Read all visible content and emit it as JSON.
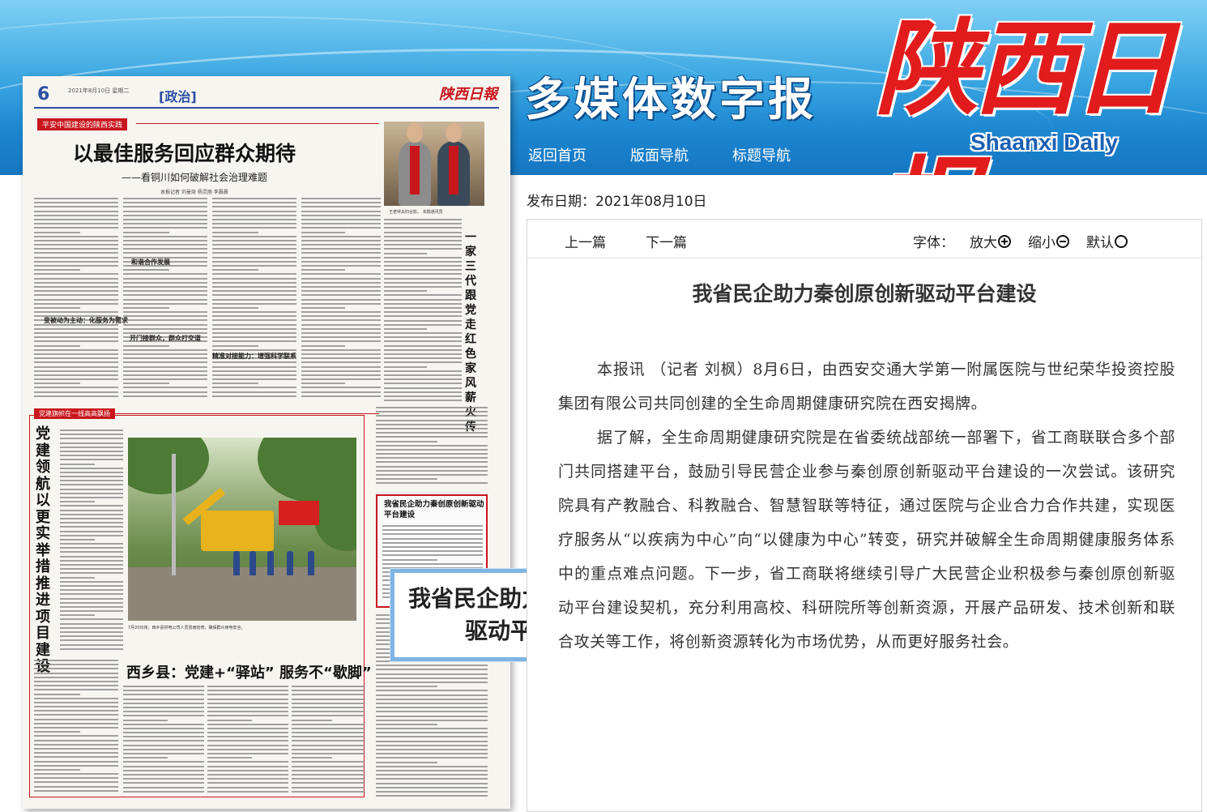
{
  "header": {
    "site_title": "多媒体数字报",
    "logo_cn": "陕西日报",
    "logo_en": "Shaanxi Daily",
    "nav": [
      "返回首页",
      "版面导航",
      "标题导航"
    ],
    "colors": {
      "header_blue": "#1c86d0",
      "logo_red": "#e21c1c"
    }
  },
  "publish": {
    "label": "发布日期：",
    "date": "2021年08月10日"
  },
  "toolbar": {
    "prev": "上一篇",
    "next": "下一篇",
    "font_label": "字体：",
    "zoom_in": "放大",
    "zoom_out": "缩小",
    "reset": "默认",
    "icons": [
      "zoom-in-icon",
      "zoom-out-icon",
      "default-size-icon"
    ]
  },
  "article": {
    "title": "我省民企助力秦创原创新驱动平台建设",
    "paragraphs": [
      "本报讯 （记者 刘枫）8月6日，由西安交通大学第一附属医院与世纪荣华投资控股集团有限公司共同创建的全生命周期健康研究院在西安揭牌。",
      "据了解，全生命周期健康研究院是在省委统战部统一部署下，省工商联联合多个部门共同搭建平台，鼓励引导民营企业参与秦创原创新驱动平台建设的一次尝试。该研究院具有产教融合、科教融合、智慧智联等特征，通过医院与企业合力合作共建，实现医疗服务从“以疾病为中心”向“以健康为中心”转变，研究并破解全生命周期健康服务体系中的重点难点问题。下一步，省工商联将继续引导广大民营企业积极参与秦创原创新驱动平台建设契机，充分利用高校、科研院所等创新资源，开展产品研发、技术创新和联合攻关等工作，将创新资源转化为市场优势，从而更好服务社会。"
    ]
  },
  "paper": {
    "page_number": "6",
    "meta": "2021年8月10日 星期二",
    "section": "[政治]",
    "logo": "陕西日報",
    "kicker1": "平安中国建设的陕西实践",
    "headline1": "以最佳服务回应群众期待",
    "subhead1": "——看铜川如何破解社会治理难题",
    "byline1": "本报记者 刘曼琦 杨灵丽 李晨晨",
    "subheads": [
      "变被动为主动：化服务为需求",
      "开门接群众，群众打交道",
      "精准对接能力：增强科学联系",
      "和谐合作发展"
    ],
    "photo1_caption": "王老伴夫妇合影。 本报通讯员 ",
    "vertical_head1": "一家三代跟党走 红色家风薪火传",
    "kicker2": "党建旗帜在一线高高飘扬",
    "vertical_head2": "党建领航以更实举措推进项目建设",
    "photo2_caption": "7月20日夜，西乡县供电公司人员冒雨抢修，确保群众用电安全。",
    "headline2": "西乡县：党建+“驿站” 服务不“歇脚”",
    "clip_title": "我省民企助力秦创原创新驱动平台建设",
    "callout": "我省民企助力秦创原创新驱动平台建设"
  }
}
